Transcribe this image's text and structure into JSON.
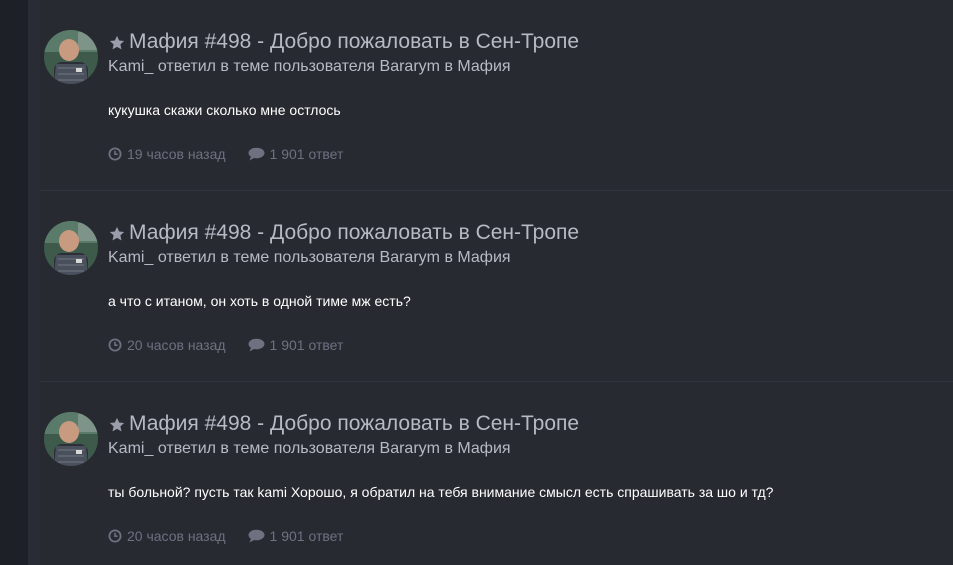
{
  "colors": {
    "background": "#24262e",
    "card": "#282a32",
    "title": "#b7bac4",
    "snippet": "#ffffff",
    "meta": "#6d7180"
  },
  "icons": {
    "star": "star-icon",
    "time": "clock-icon",
    "replies": "comment-icon"
  },
  "activities": [
    {
      "title": "Мафия #498 - Добро пожаловать в Сен-Тропе",
      "author": "Kami_",
      "action": "ответил в теме пользователя",
      "topic_owner": "Bararym",
      "in_word": "в",
      "forum": "Мафия",
      "snippet": "кукушка скажи сколько мне остлось",
      "time": "19 часов назад",
      "replies": "1 901 ответ"
    },
    {
      "title": "Мафия #498 - Добро пожаловать в Сен-Тропе",
      "author": "Kami_",
      "action": "ответил в теме пользователя",
      "topic_owner": "Bararym",
      "in_word": "в",
      "forum": "Мафия",
      "snippet": "а что с итаном, он хоть в одной тиме мж есть?",
      "time": "20 часов назад",
      "replies": "1 901 ответ"
    },
    {
      "title": "Мафия #498 - Добро пожаловать в Сен-Тропе",
      "author": "Kami_",
      "action": "ответил в теме пользователя",
      "topic_owner": "Bararym",
      "in_word": "в",
      "forum": "Мафия",
      "snippet": "ты больной? пусть так kami Хорошо, я обратил на тебя внимание смысл есть спрашивать за шо и тд?",
      "time": "20 часов назад",
      "replies": "1 901 ответ"
    }
  ]
}
